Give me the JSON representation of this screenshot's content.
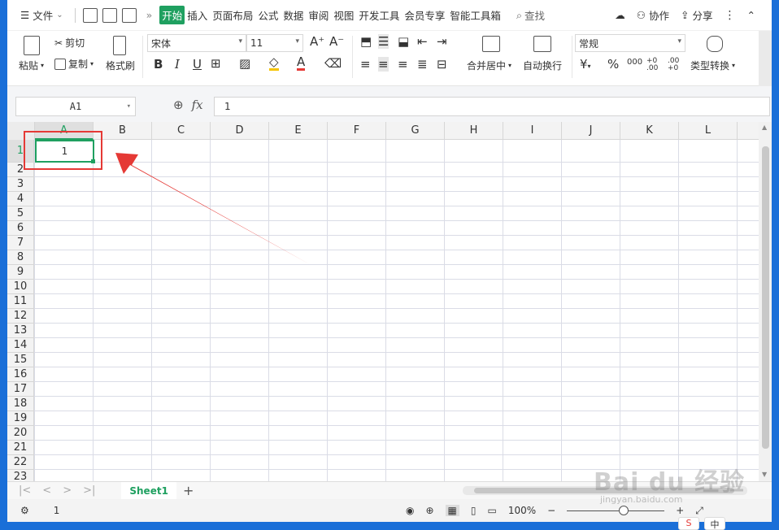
{
  "menubar": {
    "file_label": "文件",
    "tabs": [
      "开始",
      "插入",
      "页面布局",
      "公式",
      "数据",
      "审阅",
      "视图",
      "开发工具",
      "会员专享",
      "智能工具箱"
    ],
    "active_tab": "开始",
    "search_label": "查找",
    "collaborate_label": "协作",
    "share_label": "分享"
  },
  "ribbon": {
    "paste": "粘贴",
    "cut": "剪切",
    "copy": "复制",
    "format_painter": "格式刷",
    "font_name": "宋体",
    "font_size": "11",
    "merge_center": "合并居中",
    "wrap_text": "自动换行",
    "number_format": "常规",
    "type_convert": "类型转换",
    "bold": "B",
    "italic": "I",
    "underline": "U",
    "currency": "¥",
    "percent": "%",
    "thousands": "000",
    "inc_decimal": "+0 .00",
    "dec_decimal": ".00 +0"
  },
  "formula_bar": {
    "cell_ref": "A1",
    "fx": "fx",
    "value": "1"
  },
  "grid": {
    "columns": [
      "A",
      "B",
      "C",
      "D",
      "E",
      "F",
      "G",
      "H",
      "I",
      "J",
      "K",
      "L"
    ],
    "rows": [
      "1",
      "2",
      "3",
      "4",
      "5",
      "6",
      "7",
      "8",
      "9",
      "10",
      "11",
      "12",
      "13",
      "14",
      "15",
      "16",
      "17",
      "18",
      "19",
      "20",
      "21",
      "22",
      "23"
    ],
    "active_cell_value": "1"
  },
  "sheets": {
    "active": "Sheet1"
  },
  "status": {
    "sum_value": "1",
    "zoom": "100%"
  },
  "watermark": {
    "brand": "Bai du 经验",
    "url": "jingyan.baidu.com"
  },
  "colors": {
    "accent_green": "#1fa060",
    "annotation_red": "#e53935",
    "window_border": "#1a6fd8"
  }
}
